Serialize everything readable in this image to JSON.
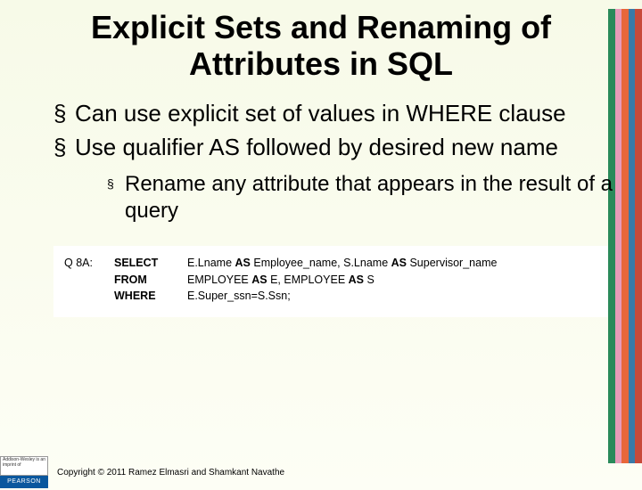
{
  "title": "Explicit Sets and Renaming of Attributes in SQL",
  "bullets": {
    "b1": "Can use explicit set of values in WHERE clause",
    "b2": "Use qualifier AS followed by desired new name",
    "sub1": "Rename any attribute that appears in the result of a query"
  },
  "query": {
    "label": "Q 8A:",
    "kw_select": "SELECT",
    "kw_from": "FROM",
    "kw_where": "WHERE",
    "select_pre1": "E.Lname ",
    "as1": "AS",
    "select_mid1": " Employee_name, S.Lname ",
    "as2": "AS",
    "select_post": " Supervisor_name",
    "from_pre1": "EMPLOYEE ",
    "as3": "AS",
    "from_mid1": " E, EMPLOYEE ",
    "as4": "AS",
    "from_post": " S",
    "where_clause": "E.Super_ssn=S.Ssn;"
  },
  "footer": {
    "logo_top": "Addison-Wesley is an imprint of",
    "logo_brand": "PEARSON",
    "copyright": "Copyright © 2011 Ramez Elmasri and Shamkant Navathe"
  }
}
